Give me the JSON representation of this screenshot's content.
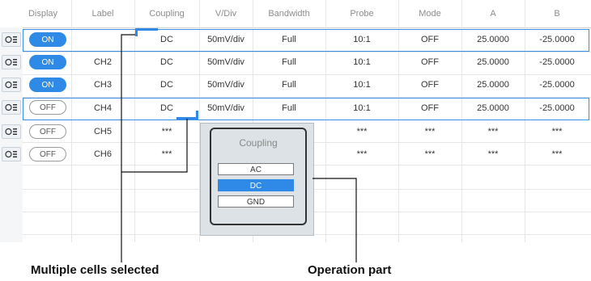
{
  "headers": [
    "Display",
    "Label",
    "Coupling",
    "V/Div",
    "Bandwidth",
    "Probe",
    "Mode",
    "A",
    "B"
  ],
  "rows": [
    {
      "display": "ON",
      "label": "",
      "coupling": "DC",
      "vdiv": "50mV/div",
      "bandwidth": "Full",
      "probe": "10:1",
      "mode": "OFF",
      "a": "25.0000",
      "b": "-25.0000"
    },
    {
      "display": "ON",
      "label": "CH2",
      "coupling": "DC",
      "vdiv": "50mV/div",
      "bandwidth": "Full",
      "probe": "10:1",
      "mode": "OFF",
      "a": "25.0000",
      "b": "-25.0000"
    },
    {
      "display": "ON",
      "label": "CH3",
      "coupling": "DC",
      "vdiv": "50mV/div",
      "bandwidth": "Full",
      "probe": "10:1",
      "mode": "OFF",
      "a": "25.0000",
      "b": "-25.0000"
    },
    {
      "display": "OFF",
      "label": "CH4",
      "coupling": "DC",
      "vdiv": "50mV/div",
      "bandwidth": "Full",
      "probe": "10:1",
      "mode": "OFF",
      "a": "25.0000",
      "b": "-25.0000"
    },
    {
      "display": "OFF",
      "label": "CH5",
      "coupling": "***",
      "vdiv": "",
      "bandwidth": "",
      "probe": "***",
      "mode": "***",
      "a": "***",
      "b": "***"
    },
    {
      "display": "OFF",
      "label": "CH6",
      "coupling": "***",
      "vdiv": "",
      "bandwidth": "",
      "probe": "***",
      "mode": "***",
      "a": "***",
      "b": "***"
    }
  ],
  "popup": {
    "title": "Coupling",
    "options": [
      "AC",
      "DC",
      "GND"
    ],
    "selected": "DC"
  },
  "callouts": {
    "multiple_cells": "Multiple cells selected",
    "operation_part": "Operation part"
  },
  "colors": {
    "accent": "#2e8ae6",
    "toggle_on": "#2e8ae6",
    "grid": "#e6e6e6"
  },
  "icons": {
    "row_handle": "channel-settings-icon"
  }
}
